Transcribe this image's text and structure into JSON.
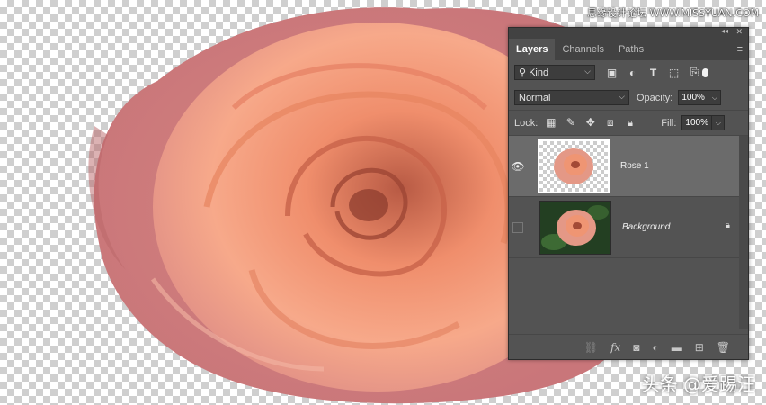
{
  "watermark": {
    "top": "思缘设计论坛 WWW.MISSYUAN.COM",
    "bottom": "头条 @爱踢汪"
  },
  "panel": {
    "tabs": [
      "Layers",
      "Channels",
      "Paths"
    ],
    "active_tab": "Layers",
    "filter": {
      "kind_label": "Kind"
    },
    "blend": {
      "mode": "Normal",
      "opacity_label": "Opacity:",
      "opacity_value": "100%"
    },
    "lock": {
      "label": "Lock:",
      "fill_label": "Fill:",
      "fill_value": "100%"
    },
    "layers": [
      {
        "name": "Rose 1",
        "visible": true,
        "selected": true
      },
      {
        "name": "Background",
        "visible": false,
        "selected": false,
        "locked": true
      }
    ]
  },
  "colors": {
    "panel_bg": "#535353",
    "panel_header": "#424242",
    "selected_layer": "#6b6b6b",
    "rose_outer": "#d98a8a",
    "rose_inner": "#f4a07f"
  }
}
